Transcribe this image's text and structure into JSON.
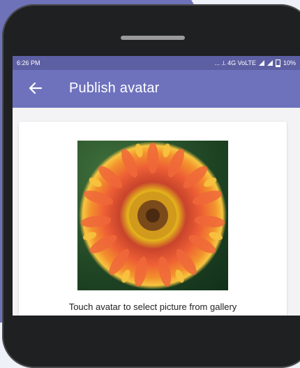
{
  "status_bar": {
    "time": "6:26 PM",
    "network": "... ⟂ 4G VoLTE",
    "battery": "10%"
  },
  "app_bar": {
    "title": "Publish avatar",
    "back_icon": "arrow-left-icon"
  },
  "content": {
    "hint": "Touch avatar to select picture from gallery"
  },
  "colors": {
    "status_bar": "#5d5fa3",
    "app_bar": "#6e72bd",
    "background_blob": "#6e72b8"
  }
}
